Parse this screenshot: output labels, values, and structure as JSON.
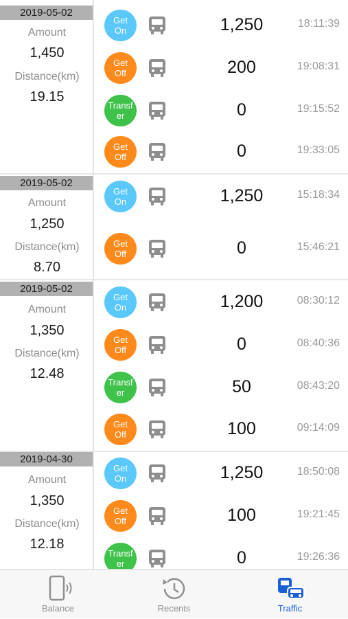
{
  "groups": [
    {
      "date": "2019-05-02",
      "amount_label": "Amount",
      "amount": "1,450",
      "distance_label": "Distance(km)",
      "distance": "19.15",
      "rows": [
        {
          "badge": "Get\nOn",
          "type": "on",
          "icon": "bus-icon",
          "amount": "1,250",
          "time": "18:11:39"
        },
        {
          "badge": "Get\nOff",
          "type": "off",
          "icon": "bus-icon",
          "amount": "200",
          "time": "19:08:31"
        },
        {
          "badge": "Transf\ner",
          "type": "tr",
          "icon": "bus-icon",
          "amount": "0",
          "time": "19:15:52"
        },
        {
          "badge": "Get\nOff",
          "type": "off",
          "icon": "bus-icon",
          "amount": "0",
          "time": "19:33:05"
        }
      ]
    },
    {
      "date": "2019-05-02",
      "amount_label": "Amount",
      "amount": "1,250",
      "distance_label": "Distance(km)",
      "distance": "8.70",
      "rows": [
        {
          "badge": "Get\nOn",
          "type": "on",
          "icon": "bus-icon",
          "amount": "1,250",
          "time": "15:18:34"
        },
        {
          "badge": "Get\nOff",
          "type": "off",
          "icon": "bus-icon",
          "amount": "0",
          "time": "15:46:21"
        }
      ]
    },
    {
      "date": "2019-05-02",
      "amount_label": "Amount",
      "amount": "1,350",
      "distance_label": "Distance(km)",
      "distance": "12.48",
      "rows": [
        {
          "badge": "Get\nOn",
          "type": "on",
          "icon": "bus-icon",
          "amount": "1,200",
          "time": "08:30:12"
        },
        {
          "badge": "Get\nOff",
          "type": "off",
          "icon": "bus-icon",
          "amount": "0",
          "time": "08:40:36"
        },
        {
          "badge": "Transf\ner",
          "type": "tr",
          "icon": "bus-icon",
          "amount": "50",
          "time": "08:43:20"
        },
        {
          "badge": "Get\nOff",
          "type": "off",
          "icon": "bus-icon",
          "amount": "100",
          "time": "09:14:09"
        }
      ]
    },
    {
      "date": "2019-04-30",
      "amount_label": "Amount",
      "amount": "1,350",
      "distance_label": "Distance(km)",
      "distance": "12.18",
      "rows": [
        {
          "badge": "Get\nOn",
          "type": "on",
          "icon": "bus-icon",
          "amount": "1,250",
          "time": "18:50:08"
        },
        {
          "badge": "Get\nOff",
          "type": "off",
          "icon": "bus-icon",
          "amount": "100",
          "time": "19:21:45"
        },
        {
          "badge": "Transf\ner",
          "type": "tr",
          "icon": "bus-icon",
          "amount": "0",
          "time": "19:26:36"
        }
      ]
    }
  ],
  "tabbar": {
    "tabs": [
      {
        "label": "Balance",
        "icon": "phone-nfc-icon"
      },
      {
        "label": "Recents",
        "icon": "history-icon"
      },
      {
        "label": "Traffic",
        "icon": "traffic-icon"
      }
    ],
    "active_index": 2
  },
  "colors": {
    "get_on": "#5ac8fa",
    "get_off": "#ff8a1c",
    "transfer": "#3ec24a",
    "active_tab": "#1a5fd6",
    "date_bar": "#b1b1b1"
  }
}
